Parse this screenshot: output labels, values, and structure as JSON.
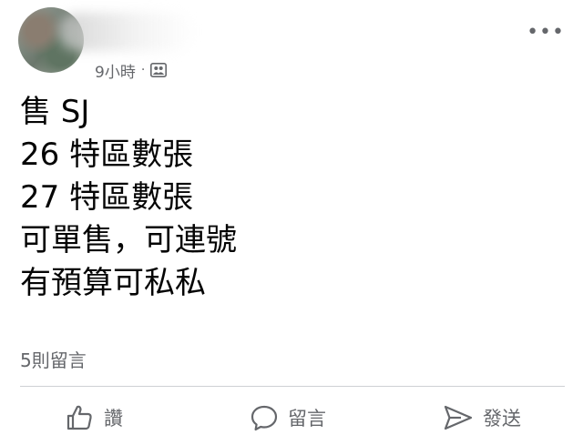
{
  "post": {
    "time": "9小時",
    "separator": "·",
    "privacy_icon": "friends-icon",
    "lines": [
      "售 SJ",
      "26 特區數張",
      "27 特區數張",
      "可單售，可連號",
      "有預算可私私"
    ],
    "comments_count": "5則留言"
  },
  "actions": {
    "like_label": "讚",
    "comment_label": "留言",
    "share_label": "發送"
  },
  "colors": {
    "text_primary": "#050505",
    "text_secondary": "#65676b",
    "divider": "#ced0d4"
  }
}
